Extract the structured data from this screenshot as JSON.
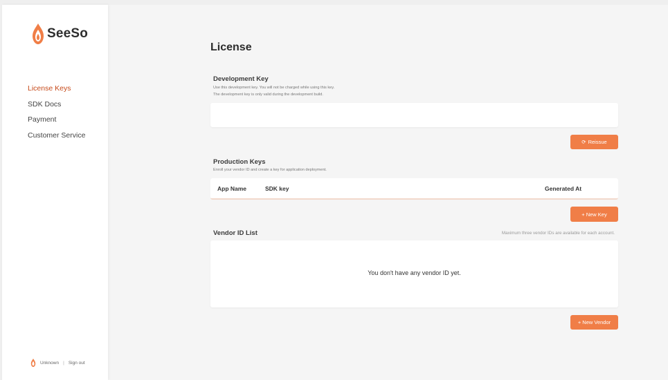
{
  "brand": {
    "name": "SeeSo",
    "accent_color": "#f07e47",
    "logo_icon": "flame-icon"
  },
  "sidebar": {
    "items": [
      {
        "label": "License Keys",
        "active": true
      },
      {
        "label": "SDK Docs",
        "active": false
      },
      {
        "label": "Payment",
        "active": false
      },
      {
        "label": "Customer Service",
        "active": false
      }
    ],
    "user": {
      "name": "Unknown",
      "separator": "|",
      "signout_label": "Sign out"
    }
  },
  "main": {
    "title": "License",
    "development": {
      "title": "Development Key",
      "desc_line1": "Use this development key. You will not be charged while using this key.",
      "desc_line2": "The development key is only valid during the development build.",
      "key_value": "",
      "reissue_label": "Reissue",
      "reissue_icon": "refresh-icon"
    },
    "production": {
      "title": "Production Keys",
      "desc": "Enroll your vendor ID and create a key for application deployment.",
      "columns": [
        "App Name",
        "SDK key",
        "Generated At"
      ],
      "rows": [],
      "new_key_label": "+ New Key"
    },
    "vendor": {
      "title": "Vendor ID List",
      "hint": "Maximum three vendor IDs are available for each account.",
      "empty_message": "You don't have any vendor ID yet.",
      "new_vendor_label": "+ New Vendor"
    }
  }
}
